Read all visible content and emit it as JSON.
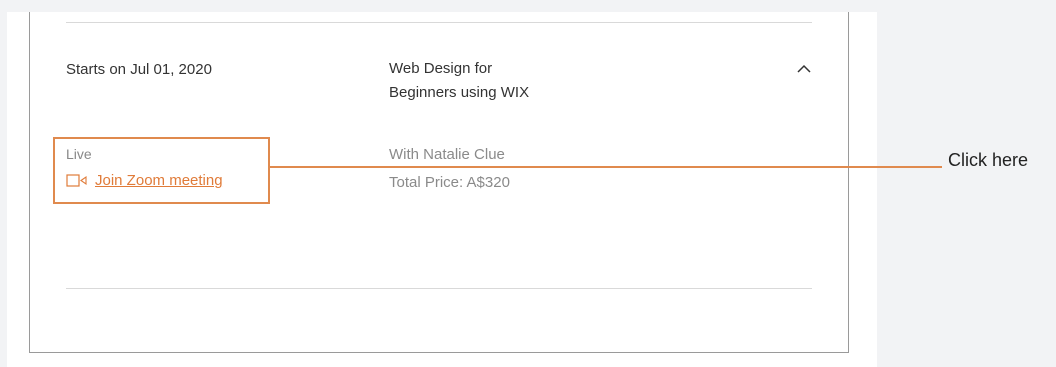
{
  "session": {
    "start_date": "Starts on Jul 01, 2020",
    "course_title_line1": "Web Design for",
    "course_title_line2": "Beginners using WIX",
    "mode": "Live",
    "join_link": "Join Zoom meeting",
    "instructor": "With Natalie Clue",
    "price": "Total Price: A$320"
  },
  "icons": {
    "collapse": "chevron-up-icon",
    "video": "video-camera-icon"
  },
  "annotation": {
    "label": "Click here",
    "color": "#e08a4e"
  },
  "colors": {
    "link": "#e07b39",
    "muted_text": "#8a8a8a",
    "body_text": "#333333"
  }
}
